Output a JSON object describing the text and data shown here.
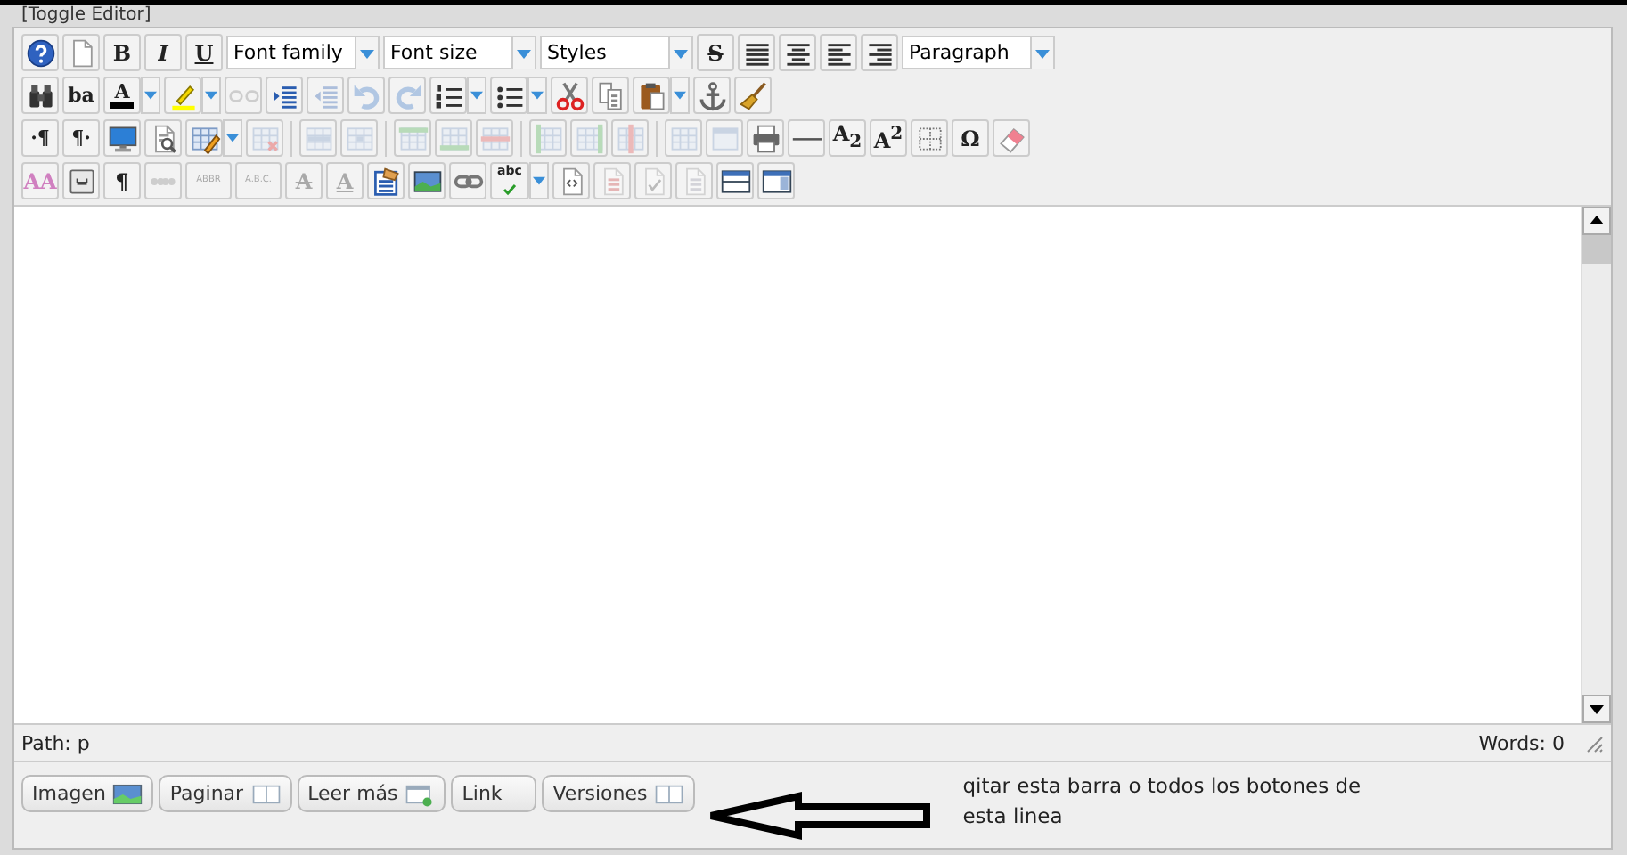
{
  "toggle_link": "[Toggle Editor]",
  "toolbars": [
    {
      "items": [
        {
          "kind": "help",
          "disabled": false,
          "dropdown": false
        },
        {
          "kind": "new-document",
          "disabled": false,
          "dropdown": false
        },
        {
          "kind": "bold",
          "glyph": "B",
          "disabled": false,
          "dropdown": false
        },
        {
          "kind": "italic",
          "glyph": "I",
          "disabled": false,
          "dropdown": false
        },
        {
          "kind": "underline",
          "glyph": "U",
          "disabled": false,
          "dropdown": false
        },
        {
          "kind": "select",
          "label": "Font family"
        },
        {
          "kind": "select",
          "label": "Font size"
        },
        {
          "kind": "select",
          "label": "Styles"
        },
        {
          "kind": "strikethrough",
          "glyph": "S",
          "disabled": false,
          "dropdown": false
        },
        {
          "kind": "justify",
          "disabled": false,
          "dropdown": false
        },
        {
          "kind": "align-center",
          "disabled": false,
          "dropdown": false
        },
        {
          "kind": "align-left",
          "disabled": false,
          "dropdown": false
        },
        {
          "kind": "align-right",
          "disabled": false,
          "dropdown": false
        },
        {
          "kind": "select",
          "label": "Paragraph"
        }
      ]
    },
    {
      "items": [
        {
          "kind": "find",
          "disabled": false,
          "dropdown": false
        },
        {
          "kind": "replace",
          "glyph": "ba",
          "disabled": false,
          "dropdown": false
        },
        {
          "kind": "text-color",
          "glyph": "A",
          "disabled": false,
          "dropdown": true
        },
        {
          "kind": "highlight",
          "disabled": false,
          "dropdown": true
        },
        {
          "kind": "unlink",
          "disabled": true,
          "dropdown": false
        },
        {
          "kind": "indent",
          "disabled": false,
          "dropdown": false
        },
        {
          "kind": "outdent",
          "disabled": true,
          "dropdown": false
        },
        {
          "kind": "undo",
          "disabled": true,
          "dropdown": false
        },
        {
          "kind": "redo",
          "disabled": true,
          "dropdown": false
        },
        {
          "kind": "numbered-list",
          "disabled": false,
          "dropdown": true
        },
        {
          "kind": "bullet-list",
          "disabled": false,
          "dropdown": true
        },
        {
          "kind": "cut",
          "disabled": false,
          "dropdown": false
        },
        {
          "kind": "copy",
          "disabled": false,
          "dropdown": false
        },
        {
          "kind": "paste",
          "disabled": false,
          "dropdown": true
        },
        {
          "kind": "anchor",
          "disabled": false,
          "dropdown": false
        },
        {
          "kind": "cleanup",
          "disabled": false,
          "dropdown": false
        }
      ]
    },
    {
      "items": [
        {
          "kind": "ltr",
          "glyph": "·¶",
          "disabled": false,
          "dropdown": false
        },
        {
          "kind": "rtl",
          "glyph": "¶·",
          "disabled": false,
          "dropdown": false
        },
        {
          "kind": "fullscreen",
          "disabled": false,
          "dropdown": false
        },
        {
          "kind": "preview",
          "disabled": false,
          "dropdown": false
        },
        {
          "kind": "table",
          "disabled": false,
          "dropdown": true
        },
        {
          "kind": "delete-table",
          "disabled": true,
          "dropdown": false
        },
        {
          "kind": "separator"
        },
        {
          "kind": "row-props",
          "disabled": true,
          "dropdown": false
        },
        {
          "kind": "cell-props",
          "disabled": true,
          "dropdown": false
        },
        {
          "kind": "separator"
        },
        {
          "kind": "row-before",
          "disabled": true,
          "dropdown": false
        },
        {
          "kind": "row-after",
          "disabled": true,
          "dropdown": false
        },
        {
          "kind": "delete-row",
          "disabled": true,
          "dropdown": false
        },
        {
          "kind": "separator"
        },
        {
          "kind": "col-before",
          "disabled": true,
          "dropdown": false
        },
        {
          "kind": "col-after",
          "disabled": true,
          "dropdown": false
        },
        {
          "kind": "delete-col",
          "disabled": true,
          "dropdown": false
        },
        {
          "kind": "separator"
        },
        {
          "kind": "merge-cells",
          "disabled": true,
          "dropdown": false
        },
        {
          "kind": "split-cells",
          "disabled": true,
          "dropdown": false
        },
        {
          "kind": "print",
          "disabled": false,
          "dropdown": false
        },
        {
          "kind": "rule",
          "disabled": false,
          "dropdown": false
        },
        {
          "kind": "subscript",
          "glyph": "A$_{2}$",
          "disabled": false,
          "dropdown": false
        },
        {
          "kind": "superscript",
          "glyph": "A$^{2}$",
          "disabled": false,
          "dropdown": false
        },
        {
          "kind": "visual-aid",
          "disabled": false,
          "dropdown": false
        },
        {
          "kind": "char-map",
          "glyph": "Ω",
          "disabled": false,
          "dropdown": false
        },
        {
          "kind": "eraser",
          "disabled": false,
          "dropdown": false
        }
      ]
    },
    {
      "items": [
        {
          "kind": "style-props",
          "glyph": "AA",
          "disabled": false,
          "dropdown": false
        },
        {
          "kind": "attributes",
          "disabled": false,
          "dropdown": false
        },
        {
          "kind": "pilcrow",
          "glyph": "¶",
          "disabled": false,
          "dropdown": false
        },
        {
          "kind": "cite",
          "disabled": true,
          "dropdown": false
        },
        {
          "kind": "abbr",
          "glyph": "ABBR",
          "disabled": true,
          "dropdown": false
        },
        {
          "kind": "acronym",
          "glyph": "A.B.C.",
          "disabled": true,
          "dropdown": false
        },
        {
          "kind": "deleted",
          "glyph": "A",
          "disabled": true,
          "dropdown": false
        },
        {
          "kind": "inserted",
          "glyph": "A",
          "disabled": true,
          "dropdown": false
        },
        {
          "kind": "template",
          "disabled": false,
          "dropdown": false
        },
        {
          "kind": "image",
          "disabled": false,
          "dropdown": false
        },
        {
          "kind": "link",
          "disabled": false,
          "dropdown": false
        },
        {
          "kind": "spellcheck",
          "glyph": "abc",
          "disabled": false,
          "dropdown": true
        },
        {
          "kind": "code",
          "disabled": false,
          "dropdown": false
        },
        {
          "kind": "layer",
          "disabled": true,
          "dropdown": false
        },
        {
          "kind": "layer-forward",
          "disabled": true,
          "dropdown": false
        },
        {
          "kind": "layer-back",
          "disabled": true,
          "dropdown": false
        },
        {
          "kind": "layout-rows",
          "disabled": false,
          "dropdown": false
        },
        {
          "kind": "layout-side",
          "disabled": false,
          "dropdown": false
        }
      ]
    }
  ],
  "status_bar": {
    "path": "Path:  p",
    "words": "Words: 0"
  },
  "bottom_buttons": [
    {
      "label": "Imagen",
      "kind": "image"
    },
    {
      "label": "Paginar",
      "kind": "panes"
    },
    {
      "label": "Leer más",
      "kind": "page-plus"
    },
    {
      "label": "Link",
      "kind": "plain"
    },
    {
      "label": "Versiones",
      "kind": "panes"
    }
  ],
  "annotation": "qitar esta barra o todos los botones de esta linea"
}
